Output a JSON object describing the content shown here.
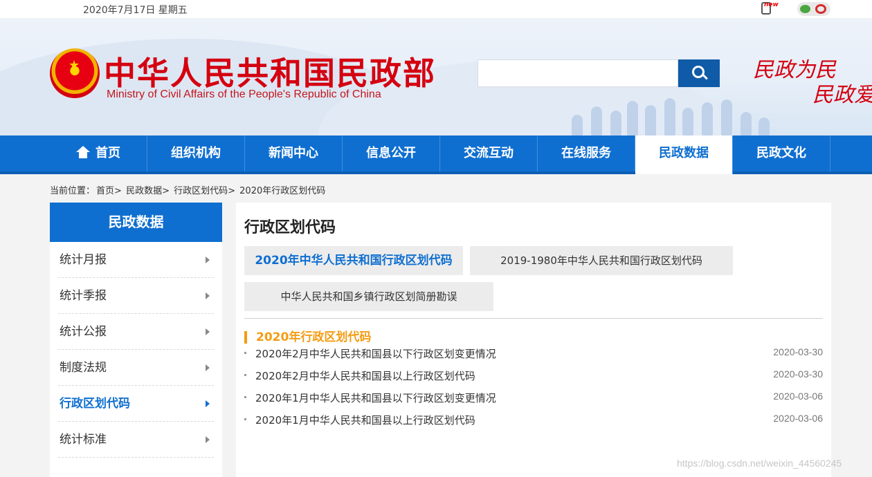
{
  "topbar": {
    "date": "2020年7月17日 星期五",
    "new_badge": "new"
  },
  "header": {
    "title": "中华人民共和国民政部",
    "subtitle": "Ministry of Civil Affairs of the People's Republic of China",
    "slogan_line1": "民政为民",
    "slogan_line2": "民政爱民",
    "search": {
      "placeholder": "",
      "value": ""
    }
  },
  "nav": {
    "items": [
      {
        "label": "首页",
        "icon": "home-icon"
      },
      {
        "label": "组织机构"
      },
      {
        "label": "新闻中心"
      },
      {
        "label": "信息公开"
      },
      {
        "label": "交流互动"
      },
      {
        "label": "在线服务"
      },
      {
        "label": "民政数据",
        "active": true
      },
      {
        "label": "民政文化"
      }
    ]
  },
  "breadcrumb": {
    "prefix": "当前位置：",
    "items": [
      "首页>",
      "民政数据>",
      "行政区划代码>",
      "2020年行政区划代码"
    ]
  },
  "sidebar": {
    "heading": "民政数据",
    "items": [
      {
        "label": "统计月报"
      },
      {
        "label": "统计季报"
      },
      {
        "label": "统计公报"
      },
      {
        "label": "制度法规"
      },
      {
        "label": "行政区划代码",
        "active": true
      },
      {
        "label": "统计标准"
      }
    ]
  },
  "main": {
    "title": "行政区划代码",
    "tabs": [
      {
        "label": "2020年中华人民共和国行政区划代码",
        "active": true
      },
      {
        "label": "2019-1980年中华人民共和国行政区划代码"
      },
      {
        "label": "中华人民共和国乡镇行政区划简册勘误"
      }
    ],
    "section_title": "2020年行政区划代码",
    "articles": [
      {
        "title": "2020年2月中华人民共和国县以下行政区划变更情况",
        "date": "2020-03-30"
      },
      {
        "title": "2020年2月中华人民共和国县以上行政区划代码",
        "date": "2020-03-30"
      },
      {
        "title": "2020年1月中华人民共和国县以下行政区划变更情况",
        "date": "2020-03-06"
      },
      {
        "title": "2020年1月中华人民共和国县以上行政区划代码",
        "date": "2020-03-06"
      }
    ]
  },
  "watermark": "https://blog.csdn.net/weixin_44560245",
  "colors": {
    "primary": "#0f6fd0",
    "brand_red": "#d40010",
    "accent_orange": "#f39c12"
  }
}
